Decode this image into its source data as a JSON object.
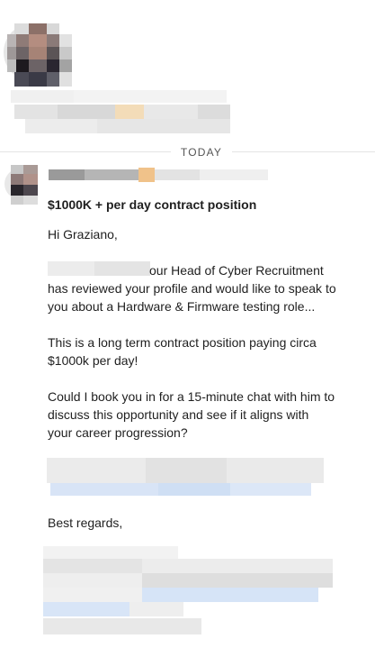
{
  "date_divider": "TODAY",
  "message": {
    "subject": "$1000K + per day contract position",
    "greeting": "Hi Graziano,",
    "para1_line1": "our Head of Cyber Recruitment",
    "para1_line2": "has reviewed your profile and would like to speak to",
    "para1_line3": "you about a Hardware & Firmware testing role...",
    "para2_line1": "This is a long term contract position paying circa",
    "para2_line2": "$1000k per day!",
    "para3_line1": "Could I book you in for a 15-minute chat with him to",
    "para3_line2": "discuss this opportunity and see if it aligns with",
    "para3_line3": "your career progression?",
    "signoff": "Best regards,"
  },
  "colors": {
    "divider": "#e4e4e4",
    "text": "#1f1f1f",
    "redacted_gray": "#e2e2e2",
    "redacted_blue": "#d4e2f5",
    "redacted_orange": "#f3dcb8"
  }
}
